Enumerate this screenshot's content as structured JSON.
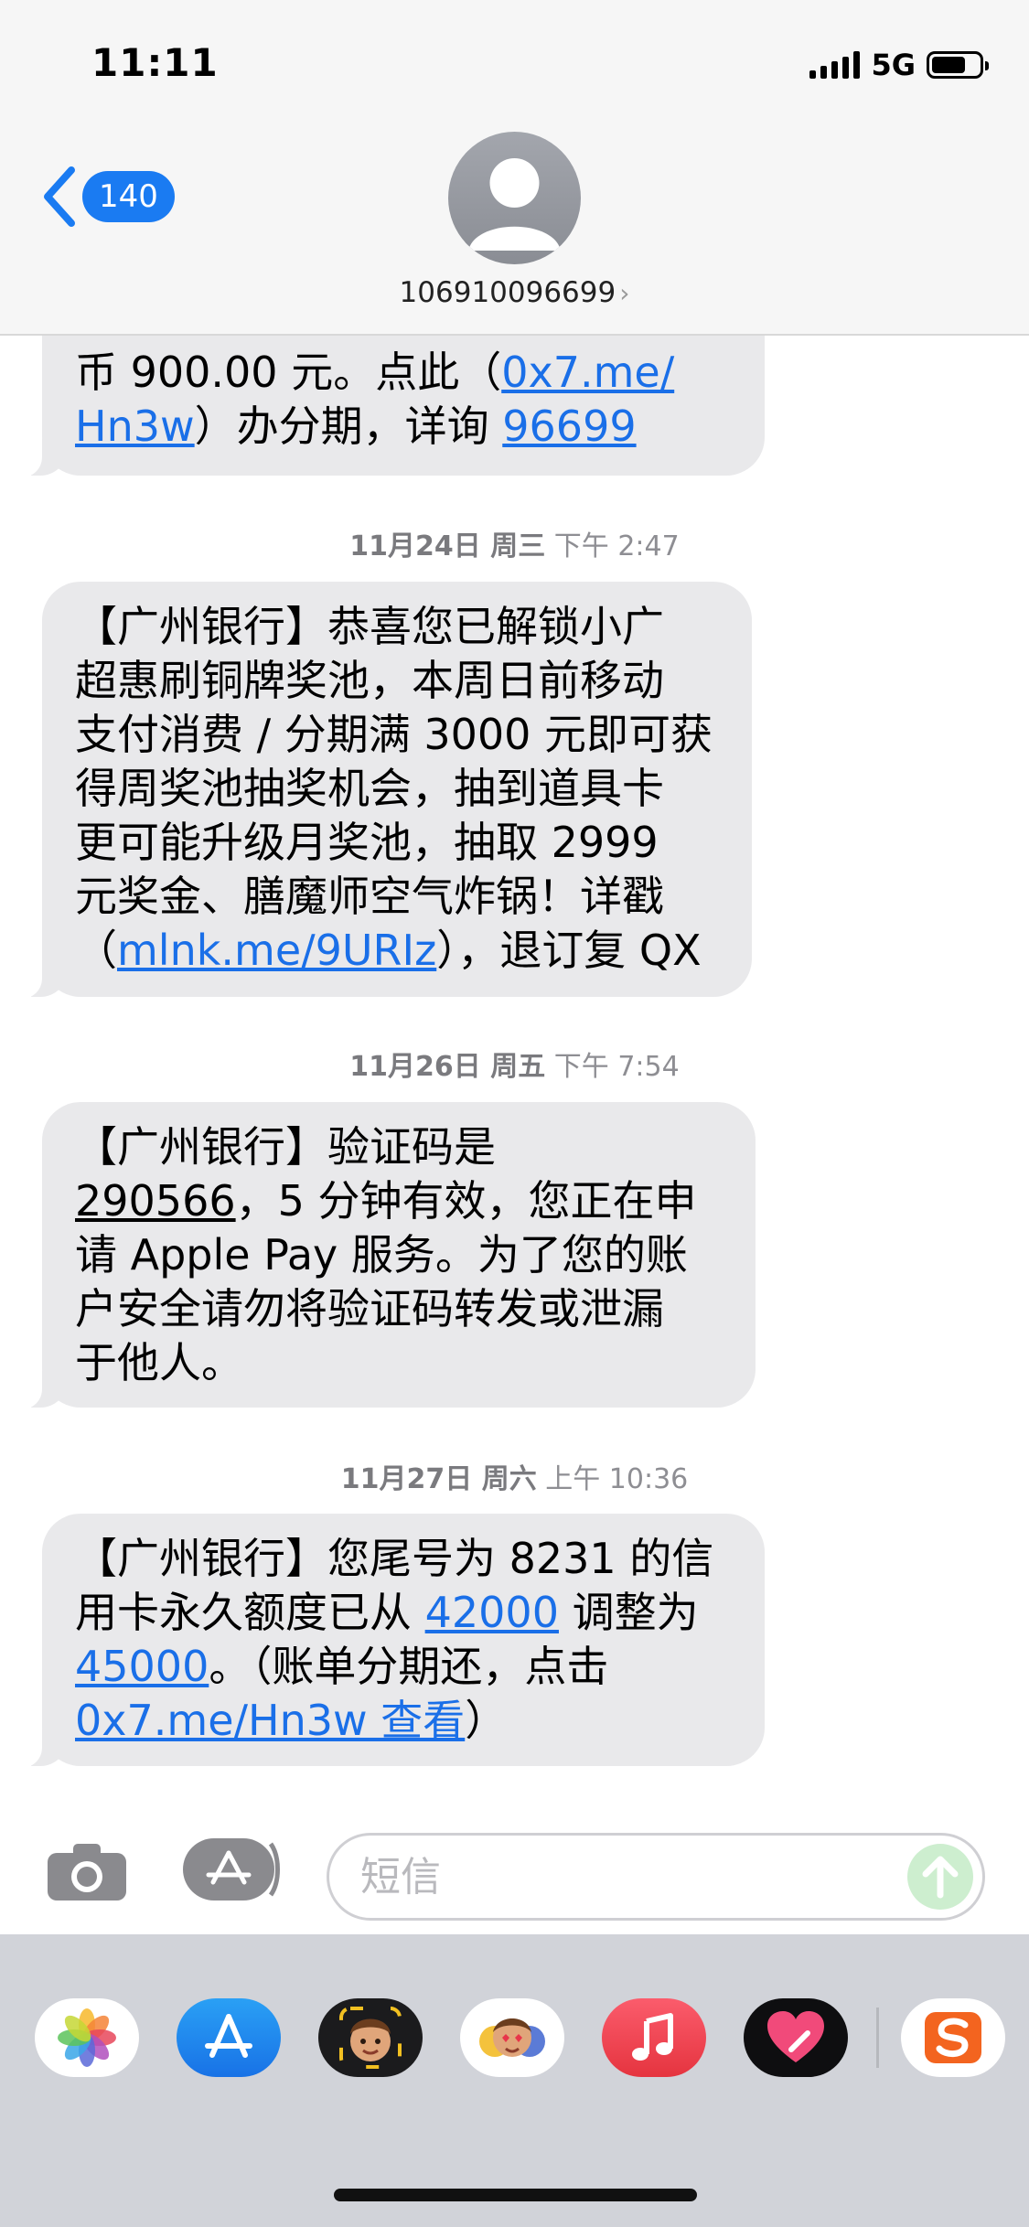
{
  "status_bar": {
    "time": "11:11",
    "network": "5G"
  },
  "header": {
    "back_count": "140",
    "contact": "106910096699"
  },
  "messages": [
    {
      "partial": true,
      "lines": [
        [
          {
            "t": "币 900.00 元。点此（"
          },
          {
            "t": "0x7.me/",
            "link": true
          }
        ],
        [
          {
            "t": "Hn3w",
            "link": true
          },
          {
            "t": "）办分期，详询 "
          },
          {
            "t": "96699",
            "link": true
          }
        ]
      ]
    },
    {
      "timestamp_date": "11月24日 周三",
      "timestamp_time": "下午 2:47",
      "lines": [
        [
          {
            "t": "【广州银行】恭喜您已解锁小广"
          }
        ],
        [
          {
            "t": "超惠刷铜牌奖池，本周日前移动"
          }
        ],
        [
          {
            "t": "支付消费 / 分期满 3000 元即可获"
          }
        ],
        [
          {
            "t": "得周奖池抽奖机会，抽到道具卡"
          }
        ],
        [
          {
            "t": "更可能升级月奖池，抽取 2999"
          }
        ],
        [
          {
            "t": "元奖金、膳魔师空气炸锅！详戳"
          }
        ],
        [
          {
            "t": "（"
          },
          {
            "t": "mlnk.me/9URIz",
            "link": true
          },
          {
            "t": "），退订复 QX"
          }
        ]
      ]
    },
    {
      "timestamp_date": "11月26日 周五",
      "timestamp_time": "下午 7:54",
      "lines": [
        [
          {
            "t": "【广州银行】验证码是"
          }
        ],
        [
          {
            "t": "290566",
            "ul": true
          },
          {
            "t": "，5 分钟有效，您正在申"
          }
        ],
        [
          {
            "t": "请 Apple Pay 服务。为了您的账"
          }
        ],
        [
          {
            "t": "户安全请勿将验证码转发或泄漏"
          }
        ],
        [
          {
            "t": "于他人。"
          }
        ]
      ]
    },
    {
      "timestamp_date": "11月27日 周六",
      "timestamp_time": "上午 10:36",
      "lines": [
        [
          {
            "t": "【广州银行】您尾号为 8231 的信"
          }
        ],
        [
          {
            "t": "用卡永久额度已从 "
          },
          {
            "t": "42000",
            "link": true
          },
          {
            "t": " 调整为"
          }
        ],
        [
          {
            "t": "45000",
            "link": true
          },
          {
            "t": "。（账单分期还，点击"
          }
        ],
        [
          {
            "t": "0x7.me/Hn3w 查看",
            "link": true
          },
          {
            "t": "）"
          }
        ]
      ]
    }
  ],
  "input": {
    "placeholder": "短信"
  },
  "drawer_icons": [
    "photos-icon",
    "app-store-icon",
    "memoji-icon",
    "memoji-stickers-icon",
    "music-icon",
    "digital-touch-icon",
    "sogou-keyboard-icon"
  ],
  "colors": {
    "link": "#1a6fe8",
    "bubble": "#e9e9eb",
    "badge": "#1a7bf2"
  }
}
